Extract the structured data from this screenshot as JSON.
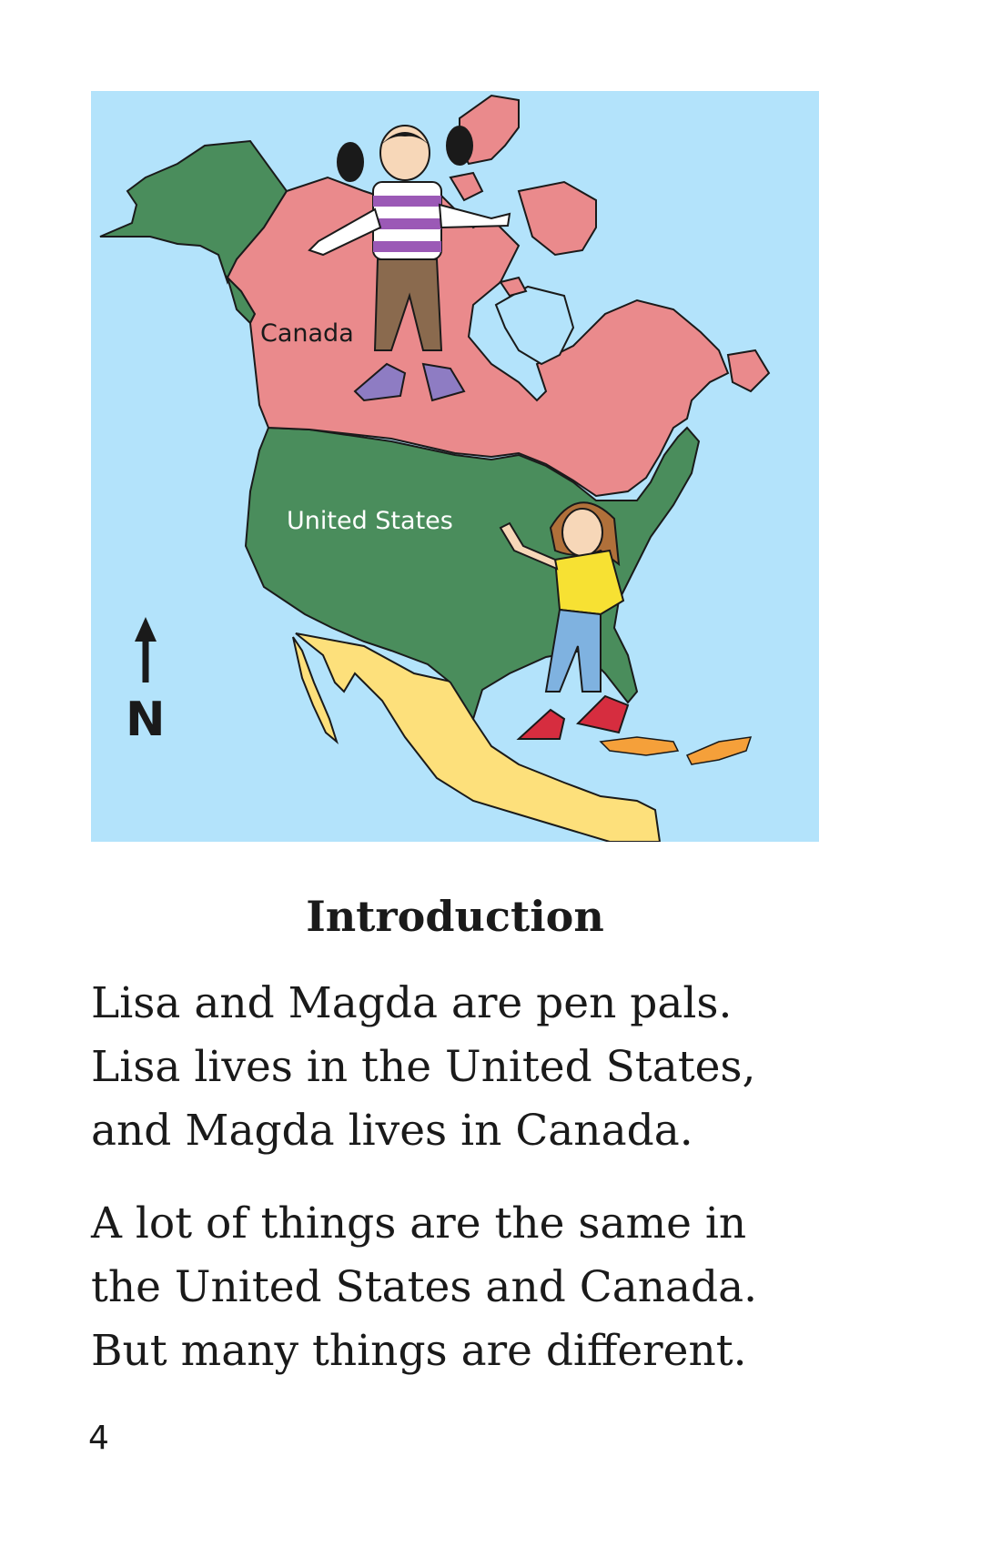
{
  "map": {
    "labels": {
      "canada": "Canada",
      "united_states": "United States"
    },
    "compass_letter": "N",
    "colors": {
      "water": "#b3e3fb",
      "canada": "#ea8a8c",
      "united_states": "#4a8d5c",
      "mexico": "#fde07b",
      "caribbean": "#f5a03a",
      "outline": "#1a1a1a"
    }
  },
  "heading": "Introduction",
  "paragraphs": [
    {
      "lines": [
        "Lisa and Magda are pen pals.",
        "Lisa lives in the United States,",
        "and Magda lives in Canada."
      ]
    },
    {
      "lines": [
        "A lot of things are the same in",
        "the United States and Canada.",
        "But many things are different."
      ]
    }
  ],
  "page_number": "4"
}
